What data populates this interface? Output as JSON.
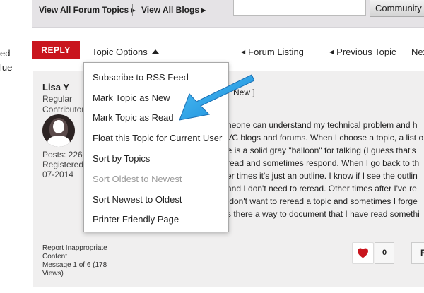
{
  "top_nav": {
    "forum_topics": "View All Forum Topics",
    "blogs": "View All Blogs",
    "community_button": "Community",
    "triangle": "▶"
  },
  "left_cut": {
    "line1": "ed",
    "line2": "lue"
  },
  "nav": {
    "reply": "REPLY",
    "topic_options": "Topic Options",
    "forum_listing": "Forum Listing",
    "previous_topic": "Previous Topic",
    "next": "Nex",
    "left_triangle": "◀"
  },
  "menu": {
    "items": [
      {
        "label": "Subscribe to RSS Feed",
        "enabled": true
      },
      {
        "label": "Mark Topic as New",
        "enabled": true
      },
      {
        "label": "Mark Topic as Read",
        "enabled": true
      },
      {
        "label": "Float this Topic for Current User",
        "enabled": true
      },
      {
        "label": "Sort by Topics",
        "enabled": true
      },
      {
        "label": "Sort Oldest to Newest",
        "enabled": false
      },
      {
        "label": "Sort Newest to Oldest",
        "enabled": true
      },
      {
        "label": "Printer Friendly Page",
        "enabled": true
      }
    ]
  },
  "post": {
    "author": "Lisa Y",
    "rank_line1": "Regular",
    "rank_line2": "Contributor",
    "posts": "Posts: 226",
    "registered": "Registered",
    "date": "07-2014",
    "subject_fragment": "New ]",
    "body_lines": [
      "omeone can understand my technical problem and  h",
      "QVC blogs and forums. When I choose a topic, a list o",
      "ere is a solid gray \"balloon\" for talking (I guess that's",
      "d read and sometimes respond. When I go back to th",
      "ther times it's just an outline. I know if I see the outlin",
      "d and I don't need to reread. Other times after I've re",
      ". I don't want to reread a topic and sometimes I forge",
      ". Is there a way to document that I have read somethi"
    ],
    "report_line1": "Report Inappropriate",
    "report_line2": "Content",
    "message_line1": "Message 1 of 6 (178",
    "message_line2": "Views)",
    "like_count": "0",
    "reply_fragment": "R"
  },
  "colors": {
    "reply_red": "#c9151e",
    "heart_red": "#c9151e",
    "arrow_blue": "#1e9be0",
    "card_bg": "#f0efef",
    "topbar_bg": "#e5e3e6"
  },
  "icons": {
    "heart": "heart-icon",
    "avatar": "avatar-silhouette",
    "annotation": "annotation-arrow"
  }
}
